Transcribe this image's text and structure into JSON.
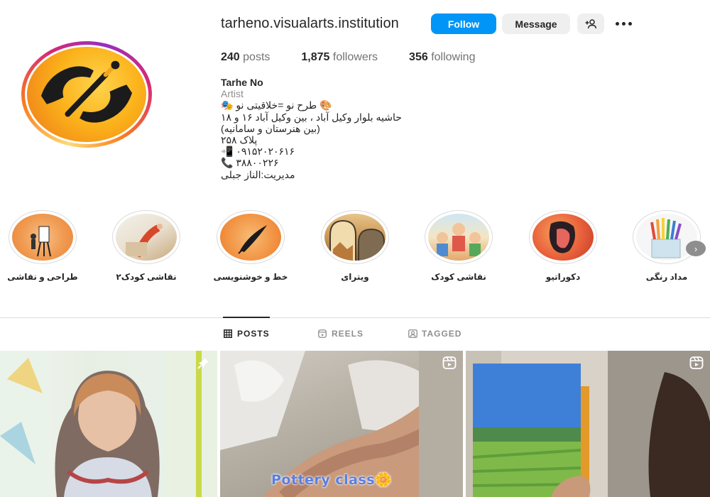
{
  "profile": {
    "username": "tarheno.visualarts.institution",
    "follow_label": "Follow",
    "message_label": "Message",
    "stats": [
      {
        "value": "240",
        "label": "posts"
      },
      {
        "value": "1,875",
        "label": "followers"
      },
      {
        "value": "356",
        "label": "following"
      }
    ],
    "bio": {
      "name": "Tarhe No",
      "category": "Artist",
      "lines": [
        "🎨 طرح نو =خلاقیتی نو 🎭",
        "حاشیه بلوار وکیل آباد ، بین وکیل آباد ۱۶ و ۱۸",
        "(بین هنرستان و سامانیه)",
        "پلاک ۲۵۸",
        "📲 ۰۹۱۵۲۰۲۰۶۱۶",
        "📞 ۳۸۸۰۰۲۲۶",
        "مدیریت:الناز جبلی"
      ]
    }
  },
  "highlights": [
    {
      "label": "طراحی و نقاشی"
    },
    {
      "label": "نقاشی کودک۲"
    },
    {
      "label": "خط و خوشنویسی"
    },
    {
      "label": "ویترای"
    },
    {
      "label": "نقاشی کودک"
    },
    {
      "label": "دکوراتیو"
    },
    {
      "label": "مداد رنگی"
    }
  ],
  "tabs": {
    "posts": "POSTS",
    "reels": "REELS",
    "tagged": "TAGGED"
  },
  "posts": {
    "pottery_caption": "Pottery class🌼"
  },
  "colors": {
    "accent": "#0095f6",
    "secondary_button": "#efefef",
    "text": "#262626",
    "muted": "#737373"
  }
}
